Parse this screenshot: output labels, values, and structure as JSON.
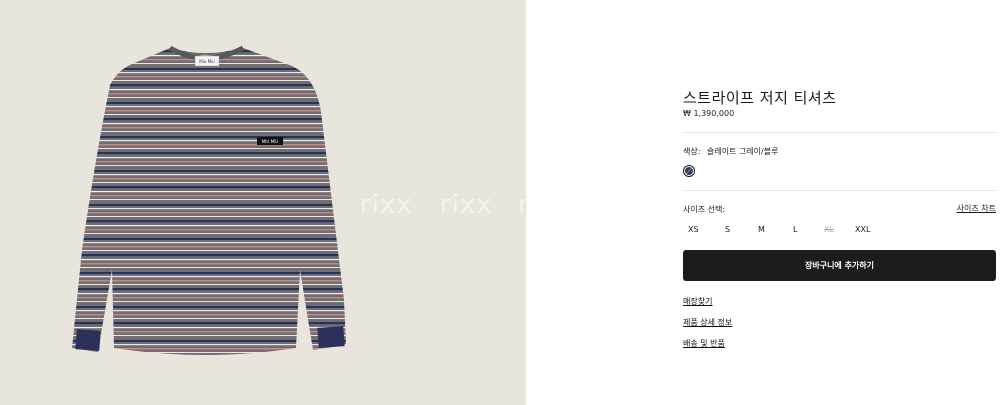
{
  "image": {
    "watermark_text": [
      "rixx",
      "rixx",
      "ri"
    ],
    "collar_label": "Miu Miu",
    "pocket_label": "MIU MIU"
  },
  "product": {
    "title": "스트라이프 저지 티셔츠",
    "price": "₩ 1,390,000"
  },
  "color": {
    "label": "색상:",
    "value": "슬레이트 그레이/블루",
    "swatch_colors": [
      "#2c3e5c",
      "#8fb1d6"
    ]
  },
  "size": {
    "label": "사이즈 선택:",
    "chart_link": "사이즈 차트",
    "options": [
      {
        "label": "XS",
        "available": true
      },
      {
        "label": "S",
        "available": true
      },
      {
        "label": "M",
        "available": true
      },
      {
        "label": "L",
        "available": true
      },
      {
        "label": "XL",
        "available": false
      },
      {
        "label": "XXL",
        "available": true
      }
    ]
  },
  "actions": {
    "add_to_cart": "장바구니에 추가하기"
  },
  "links": {
    "store_finder": "매장찾기",
    "product_details": "제품 상세 정보",
    "shipping_returns": "배송 및 반품"
  },
  "colors": {
    "page_bg": "#ffffff",
    "photo_bg": "#e9e5dd",
    "button_bg": "#1b1c1d",
    "shirt_gray": "#6f6f72",
    "stripe_navy": "#2b2f5c",
    "stripe_red": "#c98484"
  }
}
